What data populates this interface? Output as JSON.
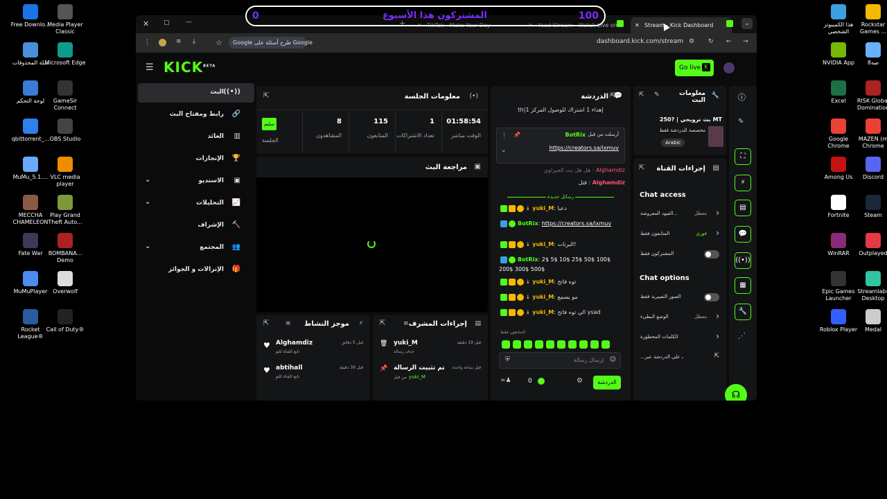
{
  "desktop": {
    "left_icons": [
      {
        "label": "Free Downlo...",
        "color": "#1a73e8"
      },
      {
        "label": "Media Player Classic",
        "color": "#555"
      },
      {
        "label": "سلة المحذوفات",
        "color": "#4a90d9"
      },
      {
        "label": "Microsoft Edge",
        "color": "#0c9b8e"
      },
      {
        "label": "لوحة التحكم",
        "color": "#3a7bd5"
      },
      {
        "label": "GameSir Connect",
        "color": "#333"
      },
      {
        "label": "qbittorrent_...",
        "color": "#2f80ed"
      },
      {
        "label": "OBS Studio",
        "color": "#444"
      },
      {
        "label": "MuMu_5.1....",
        "color": "#6aa9ff"
      },
      {
        "label": "VLC media player",
        "color": "#f08c00"
      },
      {
        "label": "MECCHA CHAMELEON",
        "color": "#8a5a44"
      },
      {
        "label": "Play Grand Theft Auto...",
        "color": "#7a9a3a"
      },
      {
        "label": "Fate War",
        "color": "#3a3a5a"
      },
      {
        "label": "BOMBANA... Demo",
        "color": "#aa2222"
      },
      {
        "label": "MuMuPlayer",
        "color": "#4a8cf0"
      },
      {
        "label": "Overwolf",
        "color": "#ddd"
      },
      {
        "label": "Rocket League®",
        "color": "#2c5aa0"
      },
      {
        "label": "Call of Duty®",
        "color": "#222"
      }
    ],
    "right_icons": [
      {
        "label": "هذا الكمبيوتر الشخصي",
        "color": "#3aa0e0"
      },
      {
        "label": "Rockstar Games ...",
        "color": "#f5b800"
      },
      {
        "label": "NVIDIA App",
        "color": "#76b900"
      },
      {
        "label": "8صه",
        "color": "#6ab0ff"
      },
      {
        "label": "Excel",
        "color": "#1d7044"
      },
      {
        "label": "RISK Global Domination",
        "color": "#aa2222"
      },
      {
        "label": "Google Chrome",
        "color": "#e94235"
      },
      {
        "label": "MAZEN (m Chrome",
        "color": "#e94235"
      },
      {
        "label": "Among Us",
        "color": "#c51111"
      },
      {
        "label": "Discord",
        "color": "#5865f2"
      },
      {
        "label": "Fortnite",
        "color": "#fff"
      },
      {
        "label": "Steam",
        "color": "#1b2838"
      },
      {
        "label": "WinRAR",
        "color": "#8a2a7a"
      },
      {
        "label": "Outplayed",
        "color": "#e63946"
      },
      {
        "label": "Epic Games Launcher",
        "color": "#333"
      },
      {
        "label": "Streamlabs Desktop",
        "color": "#31c3a2"
      },
      {
        "label": "Roblox Player",
        "color": "#335fff"
      },
      {
        "label": "Medal",
        "color": "#ccc"
      }
    ]
  },
  "overlay": {
    "title": "المشتركون هذا الأسبوع",
    "left_value": "0",
    "right_value": "100"
  },
  "browser": {
    "tabs": [
      {
        "label": "TikTok - Make Your Day"
      },
      {
        "label": "Ysad Stream - Watch Live on"
      },
      {
        "label": "Stream - Kick Dashboard"
      }
    ],
    "url": "dashboard.kick.com/stream",
    "google_pill": "طرح أسئلة على Google"
  },
  "kick": {
    "logo": "KICK",
    "logo_beta": "BETA",
    "go_live": "Go live",
    "nav": [
      {
        "label": "البث",
        "icon": "((•))",
        "active": true,
        "chev": false
      },
      {
        "label": "رابط ومفتاح البث",
        "icon": "🔗",
        "active": false,
        "chev": false
      },
      {
        "label": "العائد",
        "icon": "▥",
        "active": false,
        "chev": false
      },
      {
        "label": "الإنجازات",
        "icon": "🏆",
        "active": false,
        "chev": false
      },
      {
        "label": "الاستديو",
        "icon": "▣",
        "active": false,
        "chev": true
      },
      {
        "label": "التحليلات",
        "icon": "📈",
        "active": false,
        "chev": true
      },
      {
        "label": "الإشراف",
        "icon": "🔨",
        "active": false,
        "chev": false
      },
      {
        "label": "المجتمع",
        "icon": "👥",
        "active": false,
        "chev": true
      },
      {
        "label": "الإنزالات و الجوائز",
        "icon": "🎁",
        "active": false,
        "chev": false
      }
    ],
    "session": {
      "title": "معلومات الجلسة",
      "stats": [
        {
          "value": "01:58:54",
          "label": "الوقت مباشر"
        },
        {
          "value": "1",
          "label": "تعداد الاشتراكات"
        },
        {
          "value": "115",
          "label": "المتابعون"
        },
        {
          "value": "8",
          "label": "المشاهدون"
        }
      ],
      "session_badge": "سليم",
      "session_label": "الجلسة"
    },
    "preview": {
      "title": "مراجعة البث"
    },
    "activity": {
      "title": "موجز النشاط",
      "items": [
        {
          "user": "Alghamdiz",
          "sub": "تابع القناة للتو",
          "time": "قبل 5 دقائق"
        },
        {
          "user": "abtihall",
          "sub": "تابع القناة للتو",
          "time": "قبل 39 دقيقة"
        }
      ]
    },
    "modactions": {
      "title": "إجراءات المشرف",
      "items": [
        {
          "user": "yuki_M",
          "sub": "حذف رسالة",
          "time": "قبل 19 دقيقة"
        },
        {
          "user": "تم تثبيت الرسالة",
          "sub": "من قبل",
          "sub_user": "yuki_M",
          "time": "قبل ساعة واحدة"
        }
      ]
    },
    "chat": {
      "title": "الدردشة",
      "gift_line": "th|إهداء 1 اشتراك للوصول المركز 1",
      "pinned_by": "أرسلت من قبل",
      "pinned_user": "BotRix",
      "pinned_link": "https://creators.sa/ixmuv",
      "faded_line": "هل هل بث الجيزاوي",
      "faded_user": "Alghamdiz",
      "line1_user": "Alghamdiz",
      "line1_text": "قتل",
      "new_msgs": "رسائل جديدة",
      "msgs": [
        {
          "user": "yuki_M",
          "text": "دعبا",
          "bot": false
        },
        {
          "user": "BotRix",
          "text": "https://creators.sa/ixmuv",
          "bot": true
        },
        {
          "user": "yuki_M",
          "text": "البرنات!",
          "bot": false
        },
        {
          "user": "BotRix",
          "text": "2$ 5$ 10$ 25$ 50$ 100$ 200$ 300$ 500$",
          "bot": true
        },
        {
          "user": "yuki_M",
          "text": "توه فاتح",
          "bot": false
        },
        {
          "user": "yuki_M",
          "text": "مو يسمع",
          "bot": false
        },
        {
          "user": "yuki_M",
          "text": "الي توه فاتح ysad",
          "bot": false
        }
      ],
      "followers_only": "المتابعون فقط",
      "input_placeholder": "إرسال رسالة",
      "send": "الدردشة",
      "count": "0"
    },
    "stream_info": {
      "title": "معلومات البث",
      "stream_title": "بث ترويحي | ?250 MT",
      "category": "مخصصة للدردشة فقط",
      "language": "Arabic"
    },
    "channel_actions": {
      "title": "إجراءات القناة",
      "chat_access": "Chat access",
      "rows": [
        {
          "label": "القيود المفروضة...",
          "value": "معطل",
          "type": "chev"
        },
        {
          "label": "المتابعون فقط",
          "value": "فوري",
          "type": "chev"
        },
        {
          "label": "المشتركون فقط",
          "value": "",
          "type": "toggle"
        }
      ],
      "chat_options": "Chat options",
      "rows2": [
        {
          "label": "الصور التعبيرية فقط",
          "value": "",
          "type": "toggle"
        },
        {
          "label": "الوضع البطيء",
          "value": "معطل",
          "type": "chev"
        },
        {
          "label": "الكلمات المحظورة",
          "value": "",
          "type": "chev"
        },
        {
          "label": "...شراف على الدردشة عبر",
          "value": "",
          "type": "ext"
        }
      ]
    }
  },
  "colors": {
    "accent": "#53fc18",
    "bg": "#0b0b0b",
    "panel": "#141517"
  }
}
